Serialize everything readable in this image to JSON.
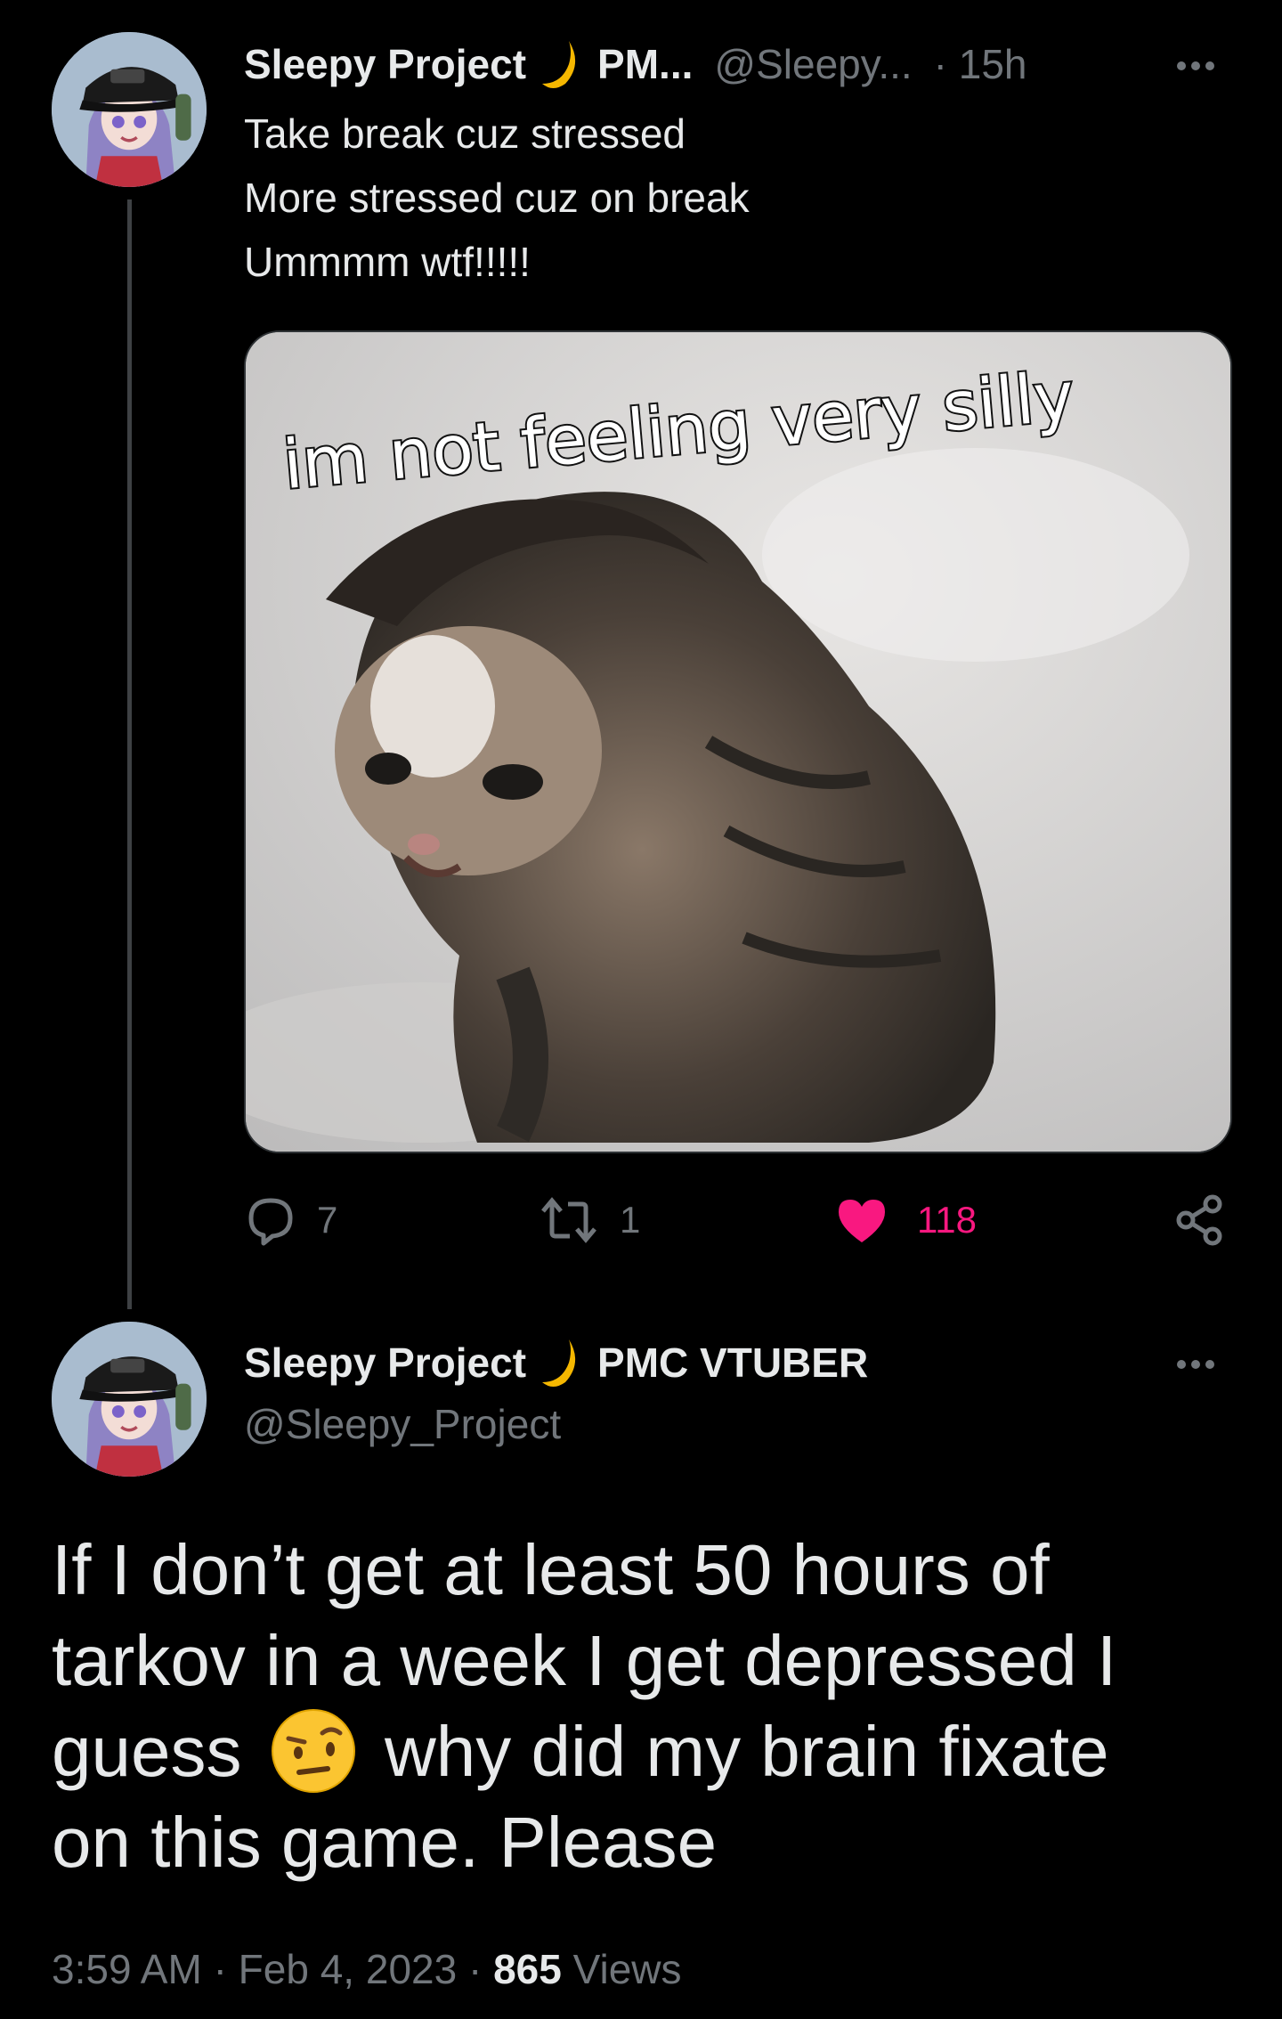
{
  "parent_tweet": {
    "display_name": "Sleepy Project",
    "name_suffix": "PM...",
    "handle": "@Sleepy...",
    "time": "· 15h",
    "lines": [
      "Take break cuz stressed",
      "More stressed cuz on break",
      "Ummmm wtf!!!!!"
    ],
    "image_caption": "im not feeling very silly",
    "actions": {
      "replies": "7",
      "retweets": "1",
      "likes": "118"
    }
  },
  "main_tweet": {
    "display_name": "Sleepy Project",
    "name_suffix": "PMC VTUBER",
    "handle": "@Sleepy_Project",
    "lines": [
      "If I don’t get at least 50 hours of",
      "tarkov in a week I get depressed I",
      "guess",
      "why did my brain fixate",
      "on this game. Please"
    ],
    "emoji": "face-with-raised-eyebrow",
    "time": "3:59 AM",
    "date": "Feb 4, 2023",
    "views_count": "865",
    "views_label": "Views"
  },
  "colors": {
    "background": "#000000",
    "text": "#e7e9ea",
    "secondary": "#71767b",
    "like": "#f91880",
    "moon": "#f5b700"
  },
  "icons": [
    "moon-icon",
    "more-icon",
    "reply-icon",
    "retweet-icon",
    "heart-icon",
    "share-icon"
  ]
}
